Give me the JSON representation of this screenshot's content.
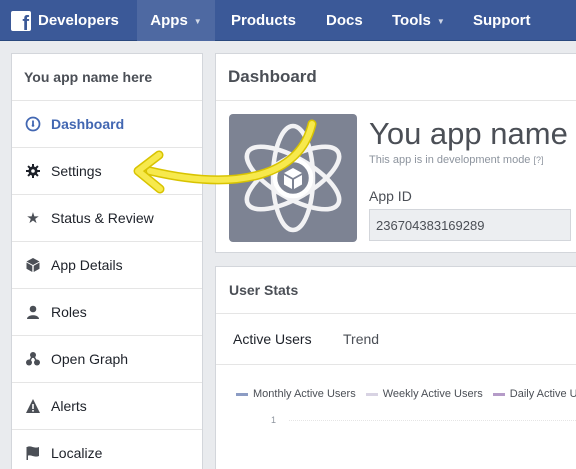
{
  "topbar": {
    "brand_label": "Developers",
    "nav": [
      {
        "label": "Apps"
      },
      {
        "label": "Products"
      },
      {
        "label": "Docs"
      },
      {
        "label": "Tools"
      },
      {
        "label": "Support"
      }
    ]
  },
  "sidebar": {
    "app_name": "You app name here",
    "items": [
      {
        "label": "Dashboard",
        "icon": "dashboard-gauge-icon"
      },
      {
        "label": "Settings",
        "icon": "gear-icon"
      },
      {
        "label": "Status & Review",
        "icon": "star-icon"
      },
      {
        "label": "App Details",
        "icon": "cube-icon"
      },
      {
        "label": "Roles",
        "icon": "person-icon"
      },
      {
        "label": "Open Graph",
        "icon": "graph-nodes-icon"
      },
      {
        "label": "Alerts",
        "icon": "warning-icon"
      },
      {
        "label": "Localize",
        "icon": "flag-icon"
      }
    ]
  },
  "dashboard": {
    "heading": "Dashboard",
    "app_title": "You app name",
    "dev_mode_text": "This app is in development mode",
    "help_marker": "[?]",
    "app_id_label": "App ID",
    "app_id_value": "236704383169289"
  },
  "user_stats": {
    "heading": "User Stats",
    "tabs": [
      {
        "label": "Active Users",
        "selected": true
      },
      {
        "label": "Trend",
        "selected": false
      }
    ],
    "legend": [
      {
        "label": "Monthly Active Users",
        "color": "#8c9cc4"
      },
      {
        "label": "Weekly Active Users",
        "color": "#d8d3e3"
      },
      {
        "label": "Daily Active Us",
        "color": "#b59bc8"
      }
    ],
    "axis_tick": "1"
  },
  "colors": {
    "topbar": "#3b5998",
    "accent": "#4267b2",
    "annotation_arrow": "#f7e94c"
  }
}
